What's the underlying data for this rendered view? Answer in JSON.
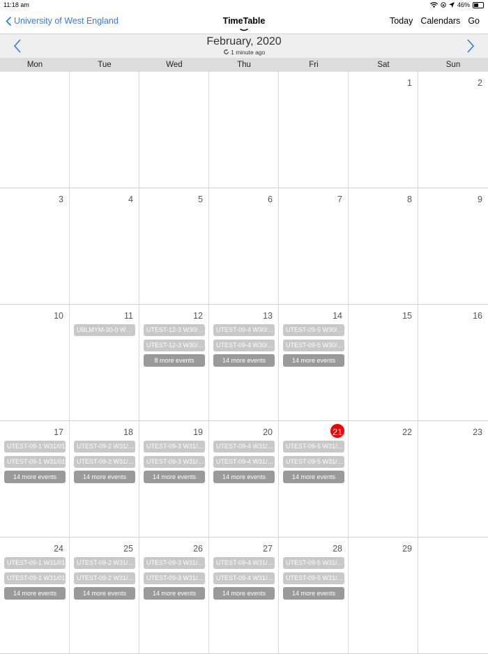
{
  "status": {
    "time": "11:18 am",
    "battery": "46%",
    "battery_level": 0.46
  },
  "nav": {
    "back_label": "University of West England",
    "title": "TimeTable",
    "today": "Today",
    "calendars": "Calendars",
    "go": "Go"
  },
  "month": {
    "label": "February, 2020",
    "sync": "1 minute ago"
  },
  "weekdays": [
    "Mon",
    "Tue",
    "Wed",
    "Thu",
    "Fri",
    "Sat",
    "Sun"
  ],
  "colors": {
    "accent": "#2b7de9",
    "today": "#f50000",
    "event": "#c8c8c8",
    "more": "#9a9a9a"
  },
  "weeks": [
    [
      "",
      "",
      "",
      "",
      "",
      "1",
      "2"
    ],
    [
      "3",
      "4",
      "5",
      "6",
      "7",
      "8",
      "9"
    ],
    [
      "10",
      "11",
      "12",
      "13",
      "14",
      "15",
      "16"
    ],
    [
      "17",
      "18",
      "19",
      "20",
      "21",
      "22",
      "23"
    ],
    [
      "24",
      "25",
      "26",
      "27",
      "28",
      "29",
      ""
    ]
  ],
  "events": {
    "11": {
      "e1": "UBLMYM-30-0 W…"
    },
    "12": {
      "e1": "UTEST-12-3 W30/…",
      "e2": "UTEST-12-3 W30/…",
      "more": "8 more events"
    },
    "13": {
      "e1": "UTEST-09-4 W30/…",
      "e2": "UTEST-09-4 W30/…",
      "more": "14 more events"
    },
    "14": {
      "e1": "UTEST-09-5 W30/…",
      "e2": "UTEST-09-5 W30/…",
      "more": "14 more events"
    },
    "17": {
      "e1": "UTEST-09-1 W31/01",
      "e2": "UTEST-09-1 W31/01",
      "more": "14 more events"
    },
    "18": {
      "e1": "UTEST-09-2 W31/…",
      "e2": "UTEST-09-2 W31/…",
      "more": "14 more events"
    },
    "19": {
      "e1": "UTEST-09-3 W31/…",
      "e2": "UTEST-09-3 W31/…",
      "more": "14 more events"
    },
    "20": {
      "e1": "UTEST-09-4 W31/…",
      "e2": "UTEST-09-4 W31/…",
      "more": "14 more events"
    },
    "21": {
      "e1": "UTEST-09-5 W31/…",
      "e2": "UTEST-09-5 W31/…",
      "more": "14 more events"
    },
    "24": {
      "e1": "UTEST-09-1 W31/01",
      "e2": "UTEST-09-1 W31/01",
      "more": "14 more events"
    },
    "25": {
      "e1": "UTEST-09-2 W31/…",
      "e2": "UTEST-09-2 W31/…",
      "more": "14 more events"
    },
    "26": {
      "e1": "UTEST-09-3 W31/…",
      "e2": "UTEST-09-3 W31/…",
      "more": "14 more events"
    },
    "27": {
      "e1": "UTEST-09-4 W31/…",
      "e2": "UTEST-09-4 W31/…",
      "more": "14 more events"
    },
    "28": {
      "e1": "UTEST-09-5 W31/…",
      "e2": "UTEST-09-5 W31/…",
      "more": "14 more events"
    }
  },
  "today_day": "21"
}
